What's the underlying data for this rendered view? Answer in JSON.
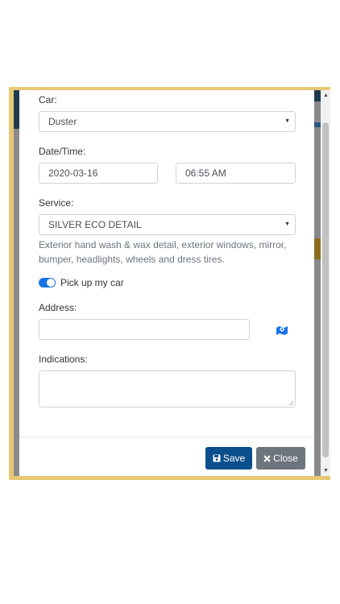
{
  "form": {
    "car_label": "Car:",
    "car_value": "Duster",
    "datetime_label": "Date/Time:",
    "date_value": "2020-03-16",
    "time_value": "06:55 AM",
    "service_label": "Service:",
    "service_value": "SILVER ECO DETAIL",
    "service_description": "Exterior hand wash & wax detail, exterior windows, mirror, bumper, headlights, wheels and dress tires.",
    "pickup_label": "Pick up my car",
    "pickup_enabled": true,
    "address_label": "Address:",
    "address_value": "",
    "indications_label": "Indications:",
    "indications_value": ""
  },
  "footer": {
    "save_label": "Save",
    "close_label": "Close"
  },
  "colors": {
    "save_button": "#0b4f8c",
    "close_button": "#6c757d",
    "toggle_on": "#1a73e8",
    "frame": "#e8c874"
  },
  "icons": {
    "save": "floppy-disk-icon",
    "close": "x-icon",
    "map": "map-marker-icon"
  }
}
